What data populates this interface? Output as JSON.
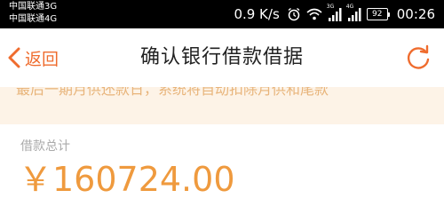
{
  "status_bar": {
    "carrier_1": "中国联通3G",
    "carrier_2": "中国联通4G",
    "network_speed": "0.9 K/s",
    "signal_1_tag": "3G",
    "signal_2_tag": "4G",
    "battery_level": "92",
    "time": "00:26",
    "icons": [
      "alarm-icon",
      "wifi-icon",
      "signal-icon",
      "battery-icon"
    ]
  },
  "nav": {
    "back_label": "返回",
    "title": "确认银行借款借据",
    "back_icon": "chevron-left-icon",
    "refresh_icon": "refresh-icon"
  },
  "notice": {
    "text": "最后一期月供还款日，系统将自动扣除月供和尾款"
  },
  "loan": {
    "total_label": "借款总计",
    "total_amount": "￥160724.00"
  },
  "colors": {
    "accent": "#ef6c2e",
    "amount": "#ef9a3e",
    "notice_bg": "#fdf3e7",
    "notice_text": "#e8b47a"
  }
}
